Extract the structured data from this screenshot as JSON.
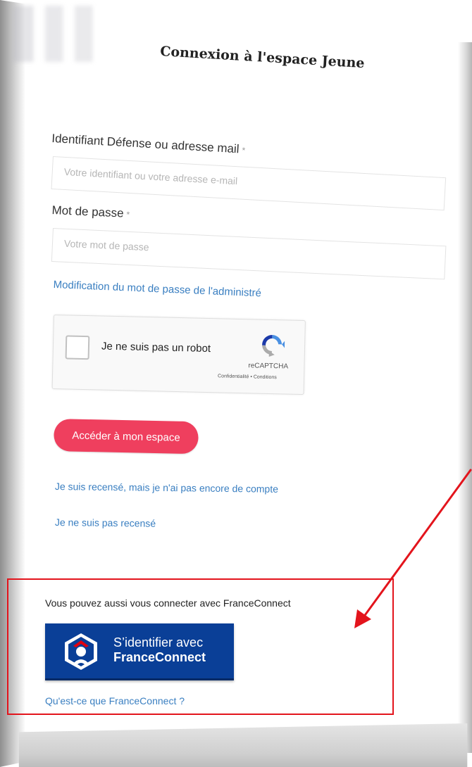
{
  "page": {
    "title": "Connexion à l'espace Jeune"
  },
  "login_form": {
    "identifier_label": "Identifiant Défense ou adresse mail",
    "identifier_required_mark": "*",
    "identifier_placeholder": "Votre identifiant ou votre adresse e-mail",
    "identifier_value": "",
    "password_label": "Mot de passe",
    "password_required_mark": "*",
    "password_placeholder": "Votre mot de passe",
    "password_value": "",
    "change_password_link": "Modification du mot de passe de l'administré",
    "submit_label": "Accéder à mon espace"
  },
  "captcha": {
    "checkbox_label": "Je ne suis pas un robot",
    "checked": false,
    "brand": "reCAPTCHA",
    "terms": "Confidentialité • Conditions",
    "icon": "recaptcha-icon"
  },
  "links": {
    "registered_no_account": "Je suis recensé, mais je n'ai pas encore de compte",
    "not_registered": "Je ne suis pas recensé"
  },
  "franceconnect": {
    "intro_text": "Vous pouvez aussi vous connecter avec FranceConnect",
    "button_line1": "S’identifier avec",
    "button_line2": "FranceConnect",
    "button_icon": "franceconnect-logo-icon",
    "info_link": "Qu'est-ce que FranceConnect ?"
  },
  "annotation": {
    "highlight_color": "#e3141c",
    "arrow_color": "#e3141c"
  },
  "colors": {
    "accent_button": "#ef3f5e",
    "link": "#3a7fc1",
    "franceconnect_blue": "#0a3f97"
  }
}
